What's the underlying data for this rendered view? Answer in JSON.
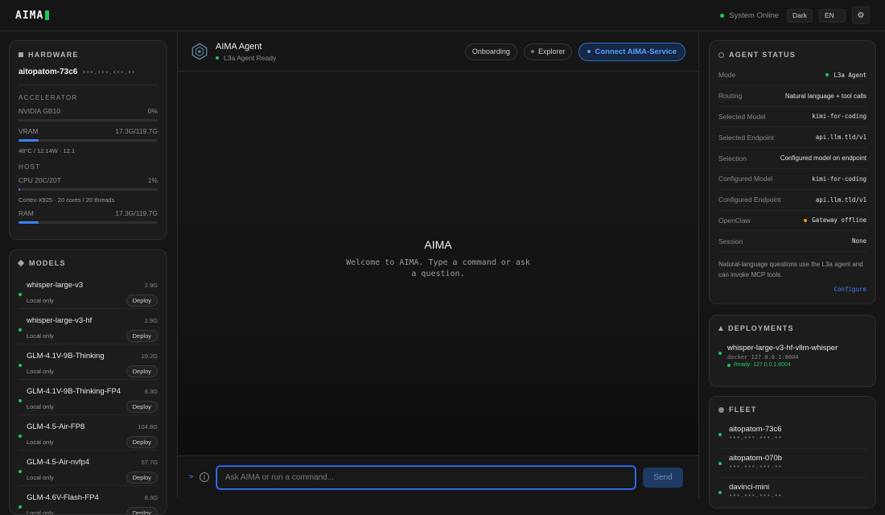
{
  "app": {
    "logo": "AIMA",
    "system_status": "System Online",
    "theme_label": "Dark",
    "lang_label": "EN",
    "settings_icon": "gear-icon"
  },
  "hardware": {
    "title": "HARDWARE",
    "hostname": "aitopatom-73c6",
    "ip": "•••.•••.•••.••",
    "accelerator_label": "ACCELERATOR",
    "gpu_name": "NVIDIA GB10",
    "gpu_util": "0%",
    "gpu_util_pct": 0,
    "vram_label": "VRAM",
    "vram_value": "17.3G/119.7G",
    "vram_pct": 14.5,
    "gpu_sub": "48°C / 12.14W · 12.1",
    "host_label": "HOST",
    "cpu_label": "CPU 20C/20T",
    "cpu_util": "1%",
    "cpu_pct": 1,
    "cpu_sub": "Cortex-X925 · 20 cores / 20 threads",
    "ram_label": "RAM",
    "ram_value": "17.3G/119.7G",
    "ram_pct": 14.5
  },
  "models": {
    "title": "MODELS",
    "deploy_label": "Deploy",
    "items": [
      {
        "name": "whisper-large-v3",
        "size": "2.9G",
        "sub": "Local only"
      },
      {
        "name": "whisper-large-v3-hf",
        "size": "2.9G",
        "sub": "Local only"
      },
      {
        "name": "GLM-4.1V-9B-Thinking",
        "size": "19.2G",
        "sub": "Local only"
      },
      {
        "name": "GLM-4.1V-9B-Thinking-FP4",
        "size": "8.3G",
        "sub": "Local only"
      },
      {
        "name": "GLM-4.5-Air-FP8",
        "size": "104.8G",
        "sub": "Local only"
      },
      {
        "name": "GLM-4.5-Air-nvfp4",
        "size": "57.7G",
        "sub": "Local only"
      },
      {
        "name": "GLM-4.6V-Flash-FP4",
        "size": "8.3G",
        "sub": "Local only"
      }
    ]
  },
  "agent": {
    "name": "AIMA Agent",
    "status": "L3a Agent Ready",
    "onboarding_label": "Onboarding",
    "explorer_label": "Explorer",
    "connect_label": "Connect AIMA-Service"
  },
  "chat": {
    "welcome_title": "AIMA",
    "welcome_text": "Welcome to AIMA. Type a command or ask a question.",
    "prompt_char": ">",
    "info_icon": "info-icon",
    "input_placeholder": "Ask AIMA or run a command...",
    "send_label": "Send"
  },
  "agent_status": {
    "title": "AGENT STATUS",
    "rows": [
      {
        "key": "Mode",
        "value": "L3a Agent",
        "mono": true,
        "dot": "green"
      },
      {
        "key": "Routing",
        "value": "Natural language + tool calls",
        "mono": false,
        "dot": ""
      },
      {
        "key": "Selected Model",
        "value": "kimi-for-coding",
        "mono": true,
        "dot": ""
      },
      {
        "key": "Selected Endpoint",
        "value": "api.llm.tld/v1",
        "mono": true,
        "dot": ""
      },
      {
        "key": "Selection",
        "value": "Configured model on endpoint",
        "mono": false,
        "dot": ""
      },
      {
        "key": "Configured Model",
        "value": "kimi-for-coding",
        "mono": true,
        "dot": ""
      },
      {
        "key": "Configured Endpoint",
        "value": "api.llm.tld/v1",
        "mono": true,
        "dot": ""
      },
      {
        "key": "OpenClaw",
        "value": "Gateway offline",
        "mono": true,
        "dot": "orange"
      },
      {
        "key": "Session",
        "value": "None",
        "mono": true,
        "dot": ""
      }
    ],
    "note": "Natural-language questions use the L3a agent and can invoke MCP tools.",
    "configure_label": "Configure"
  },
  "deployments": {
    "title": "DEPLOYMENTS",
    "items": [
      {
        "name": "whisper-large-v3-hf-vllm-whisper",
        "sub": "docker 127.0.0.1:8004",
        "ready": "Ready: 127.0.0.1:8004"
      }
    ]
  },
  "fleet": {
    "title": "FLEET",
    "items": [
      {
        "name": "aitopatom-73c6",
        "ip": "•••.•••.•••.••"
      },
      {
        "name": "aitopatom-070b",
        "ip": "•••.•••.•••.••"
      },
      {
        "name": "davinci-mini",
        "ip": "•••.•••.•••.••"
      }
    ]
  },
  "colors": {
    "accent": "#3b82f6",
    "online": "#22c55e",
    "warning": "#f59e0b"
  }
}
